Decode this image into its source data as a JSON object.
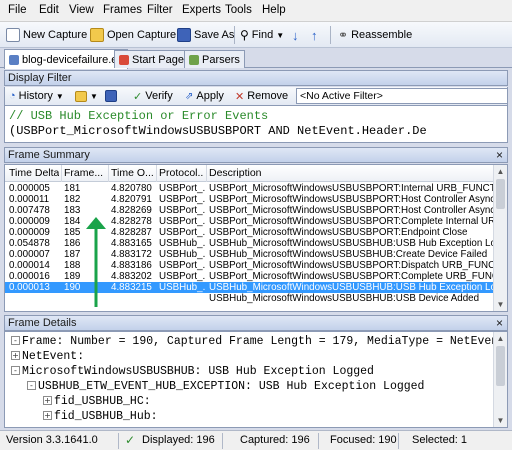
{
  "menubar": [
    "File",
    "Edit",
    "View",
    "Frames",
    "Filter",
    "Experts",
    "Tools",
    "Help"
  ],
  "toolbar": {
    "new_capture": "New Capture",
    "open_capture": "Open Capture",
    "save_as": "Save As",
    "find": "Find",
    "reassemble": "Reassemble"
  },
  "tabs": [
    {
      "label": "blog-devicefailure.etl"
    },
    {
      "label": "Start Page"
    },
    {
      "label": "Parsers"
    }
  ],
  "display_filter": {
    "title": "Display Filter",
    "history": "History",
    "verify": "Verify",
    "apply": "Apply",
    "remove": "Remove",
    "active_filter": "<No Active Filter>",
    "line1": "// USB Hub Exception or Error Events",
    "line2": "(USBPort_MicrosoftWindowsUSBUSBPORT AND NetEvent.Header.De"
  },
  "frame_summary": {
    "title": "Frame Summary",
    "columns": [
      "Time Delta",
      "Frame...",
      "Time O...",
      "Protocol...",
      "Description"
    ],
    "rows": [
      [
        "0.000005",
        "181",
        "4.820780",
        "USBPort_...",
        "USBPort_MicrosoftWindowsUSBUSBPORT:Internal URB_FUNCTION_CONTROL"
      ],
      [
        "0.000011",
        "182",
        "4.820791",
        "USBPort_...",
        "USBPort_MicrosoftWindowsUSBUSBPORT:Host Controller Async Schedule E"
      ],
      [
        "0.007478",
        "183",
        "4.828269",
        "USBPort_...",
        "USBPort_MicrosoftWindowsUSBUSBPORT:Host Controller Async Schedule"
      ],
      [
        "0.000009",
        "184",
        "4.828278",
        "USBPort_...",
        "USBPort_MicrosoftWindowsUSBUSBPORT:Complete Internal URB_FUNCTIO"
      ],
      [
        "0.000009",
        "185",
        "4.828287",
        "USBPort_...",
        "USBPort_MicrosoftWindowsUSBUSBPORT:Endpoint Close"
      ],
      [
        "0.054878",
        "186",
        "4.883165",
        "USBHub_...",
        "USBHub_MicrosoftWindowsUSBUSBHUB:USB Hub Exception Logged"
      ],
      [
        "0.000007",
        "187",
        "4.883172",
        "USBHub_...",
        "USBHub_MicrosoftWindowsUSBUSBHUB:Create Device Failed"
      ],
      [
        "0.000014",
        "188",
        "4.883186",
        "USBPort_...",
        "USBPort_MicrosoftWindowsUSBUSBPORT:Dispatch URB_FUNCTION_CONTRO"
      ],
      [
        "0.000016",
        "189",
        "4.883202",
        "USBPort_...",
        "USBPort_MicrosoftWindowsUSBUSBPORT:Complete URB_FUNCTION_CONTROL"
      ],
      [
        "0.000013",
        "190",
        "4.883215",
        "USBHub_...",
        "USBHub_MicrosoftWindowsUSBUSBHUB:USB Hub Exception Logged"
      ],
      [
        "",
        "",
        "",
        "",
        "USBHub_MicrosoftWindowsUSBUSBHUB:USB Device Added"
      ]
    ]
  },
  "frame_details": {
    "title": "Frame Details",
    "lines": [
      {
        "exp": "-",
        "text": "Frame: Number = 190, Captured Frame Length = 179, MediaType = NetEvent"
      },
      {
        "exp": "+",
        "text": "NetEvent:"
      },
      {
        "exp": "-",
        "text": "MicrosoftWindowsUSBUSBHUB: USB Hub Exception Logged"
      },
      {
        "exp": "-",
        "text": "USBHUB_ETW_EVENT_HUB_EXCEPTION: USB Hub Exception Logged"
      },
      {
        "exp": "+",
        "text": "fid_USBHUB_HC:"
      },
      {
        "exp": "+",
        "text": "fid_USBHUB_Hub:"
      }
    ]
  },
  "status": {
    "version": "Version 3.3.1641.0",
    "displayed": "Displayed: 196",
    "captured": "Captured: 196",
    "focused": "Focused: 190",
    "selected": "Selected: 1"
  },
  "colors": {
    "selection": "#3399ff",
    "arrow": "#1aa34a",
    "comment": "#2a8a2a"
  }
}
